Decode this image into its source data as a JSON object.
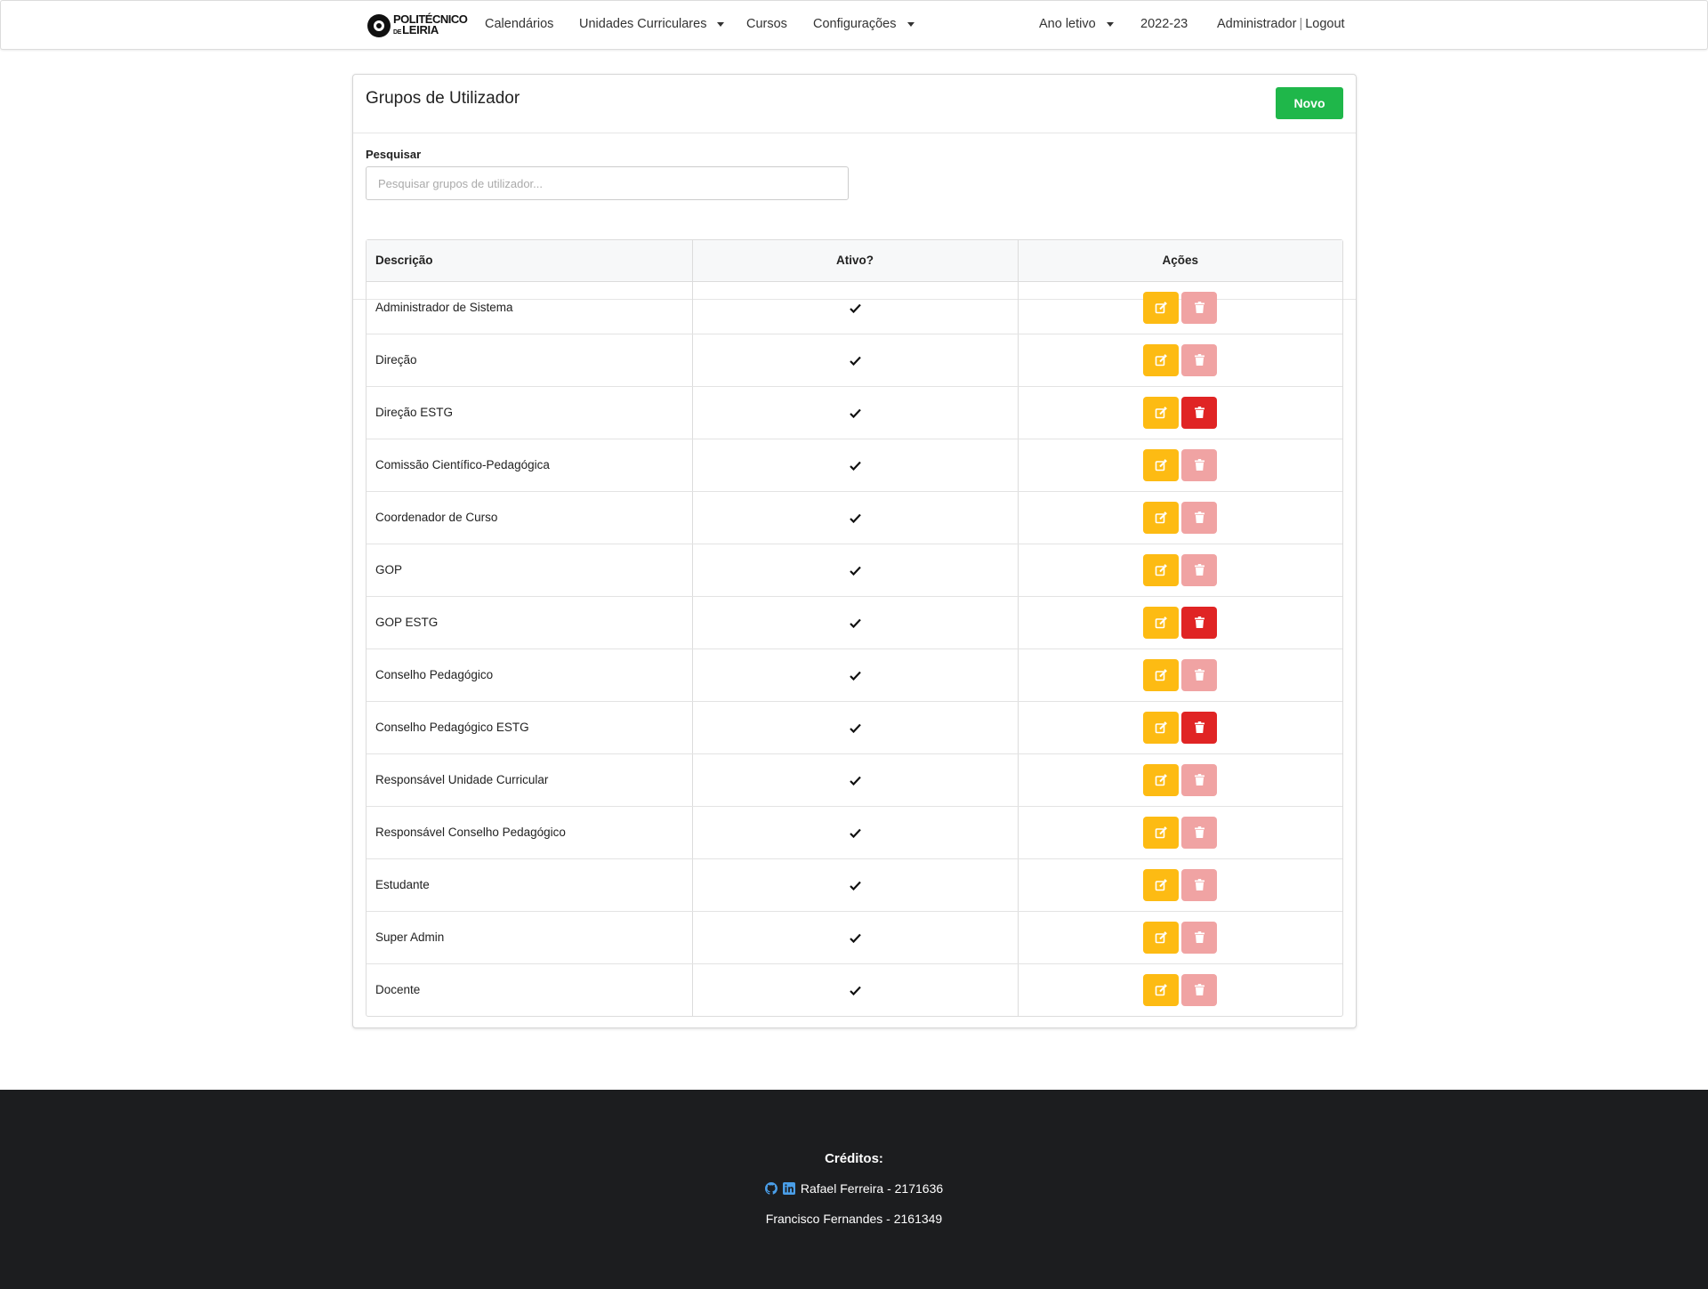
{
  "brand": {
    "line1": "POLITÉCNICO",
    "line2_small": "DE",
    "line2": "LEIRIA"
  },
  "nav": {
    "calendarios": "Calendários",
    "unidades": "Unidades Curriculares",
    "cursos": "Cursos",
    "configuracoes": "Configurações",
    "ano_letivo": "Ano letivo",
    "year": "2022-23",
    "user": "Administrador",
    "separator": "|",
    "logout": "Logout"
  },
  "page": {
    "title": "Grupos de Utilizador",
    "new_button": "Novo"
  },
  "search": {
    "label": "Pesquisar",
    "placeholder": "Pesquisar grupos de utilizador...",
    "value": ""
  },
  "table": {
    "headers": {
      "descricao": "Descrição",
      "ativo": "Ativo?",
      "acoes": "Ações"
    },
    "rows": [
      {
        "descricao": "Administrador de Sistema",
        "ativo": true,
        "delete_enabled": false
      },
      {
        "descricao": "Direção",
        "ativo": true,
        "delete_enabled": false
      },
      {
        "descricao": "Direção ESTG",
        "ativo": true,
        "delete_enabled": true
      },
      {
        "descricao": "Comissão Científico-Pedagógica",
        "ativo": true,
        "delete_enabled": false
      },
      {
        "descricao": "Coordenador de Curso",
        "ativo": true,
        "delete_enabled": false
      },
      {
        "descricao": "GOP",
        "ativo": true,
        "delete_enabled": false
      },
      {
        "descricao": "GOP ESTG",
        "ativo": true,
        "delete_enabled": true
      },
      {
        "descricao": "Conselho Pedagógico",
        "ativo": true,
        "delete_enabled": false
      },
      {
        "descricao": "Conselho Pedagógico ESTG",
        "ativo": true,
        "delete_enabled": true
      },
      {
        "descricao": "Responsável Unidade Curricular",
        "ativo": true,
        "delete_enabled": false
      },
      {
        "descricao": "Responsável Conselho Pedagógico",
        "ativo": true,
        "delete_enabled": false
      },
      {
        "descricao": "Estudante",
        "ativo": true,
        "delete_enabled": false
      },
      {
        "descricao": "Super Admin",
        "ativo": true,
        "delete_enabled": false
      },
      {
        "descricao": "Docente",
        "ativo": true,
        "delete_enabled": false
      }
    ]
  },
  "footer": {
    "title": "Créditos:",
    "credits": [
      {
        "name": "Rafael Ferreira - 2171636",
        "icons": [
          "github-icon",
          "linkedin-icon"
        ]
      },
      {
        "name": "Francisco Fernandes - 2161349",
        "icons": []
      }
    ]
  },
  "colors": {
    "success": "#1fb74a",
    "warning": "#fdbb13",
    "danger": "#e02424",
    "danger_disabled": "#f0a3a3",
    "footer_bg": "#1c1d1f",
    "icon_blue": "#4a9ee8"
  }
}
